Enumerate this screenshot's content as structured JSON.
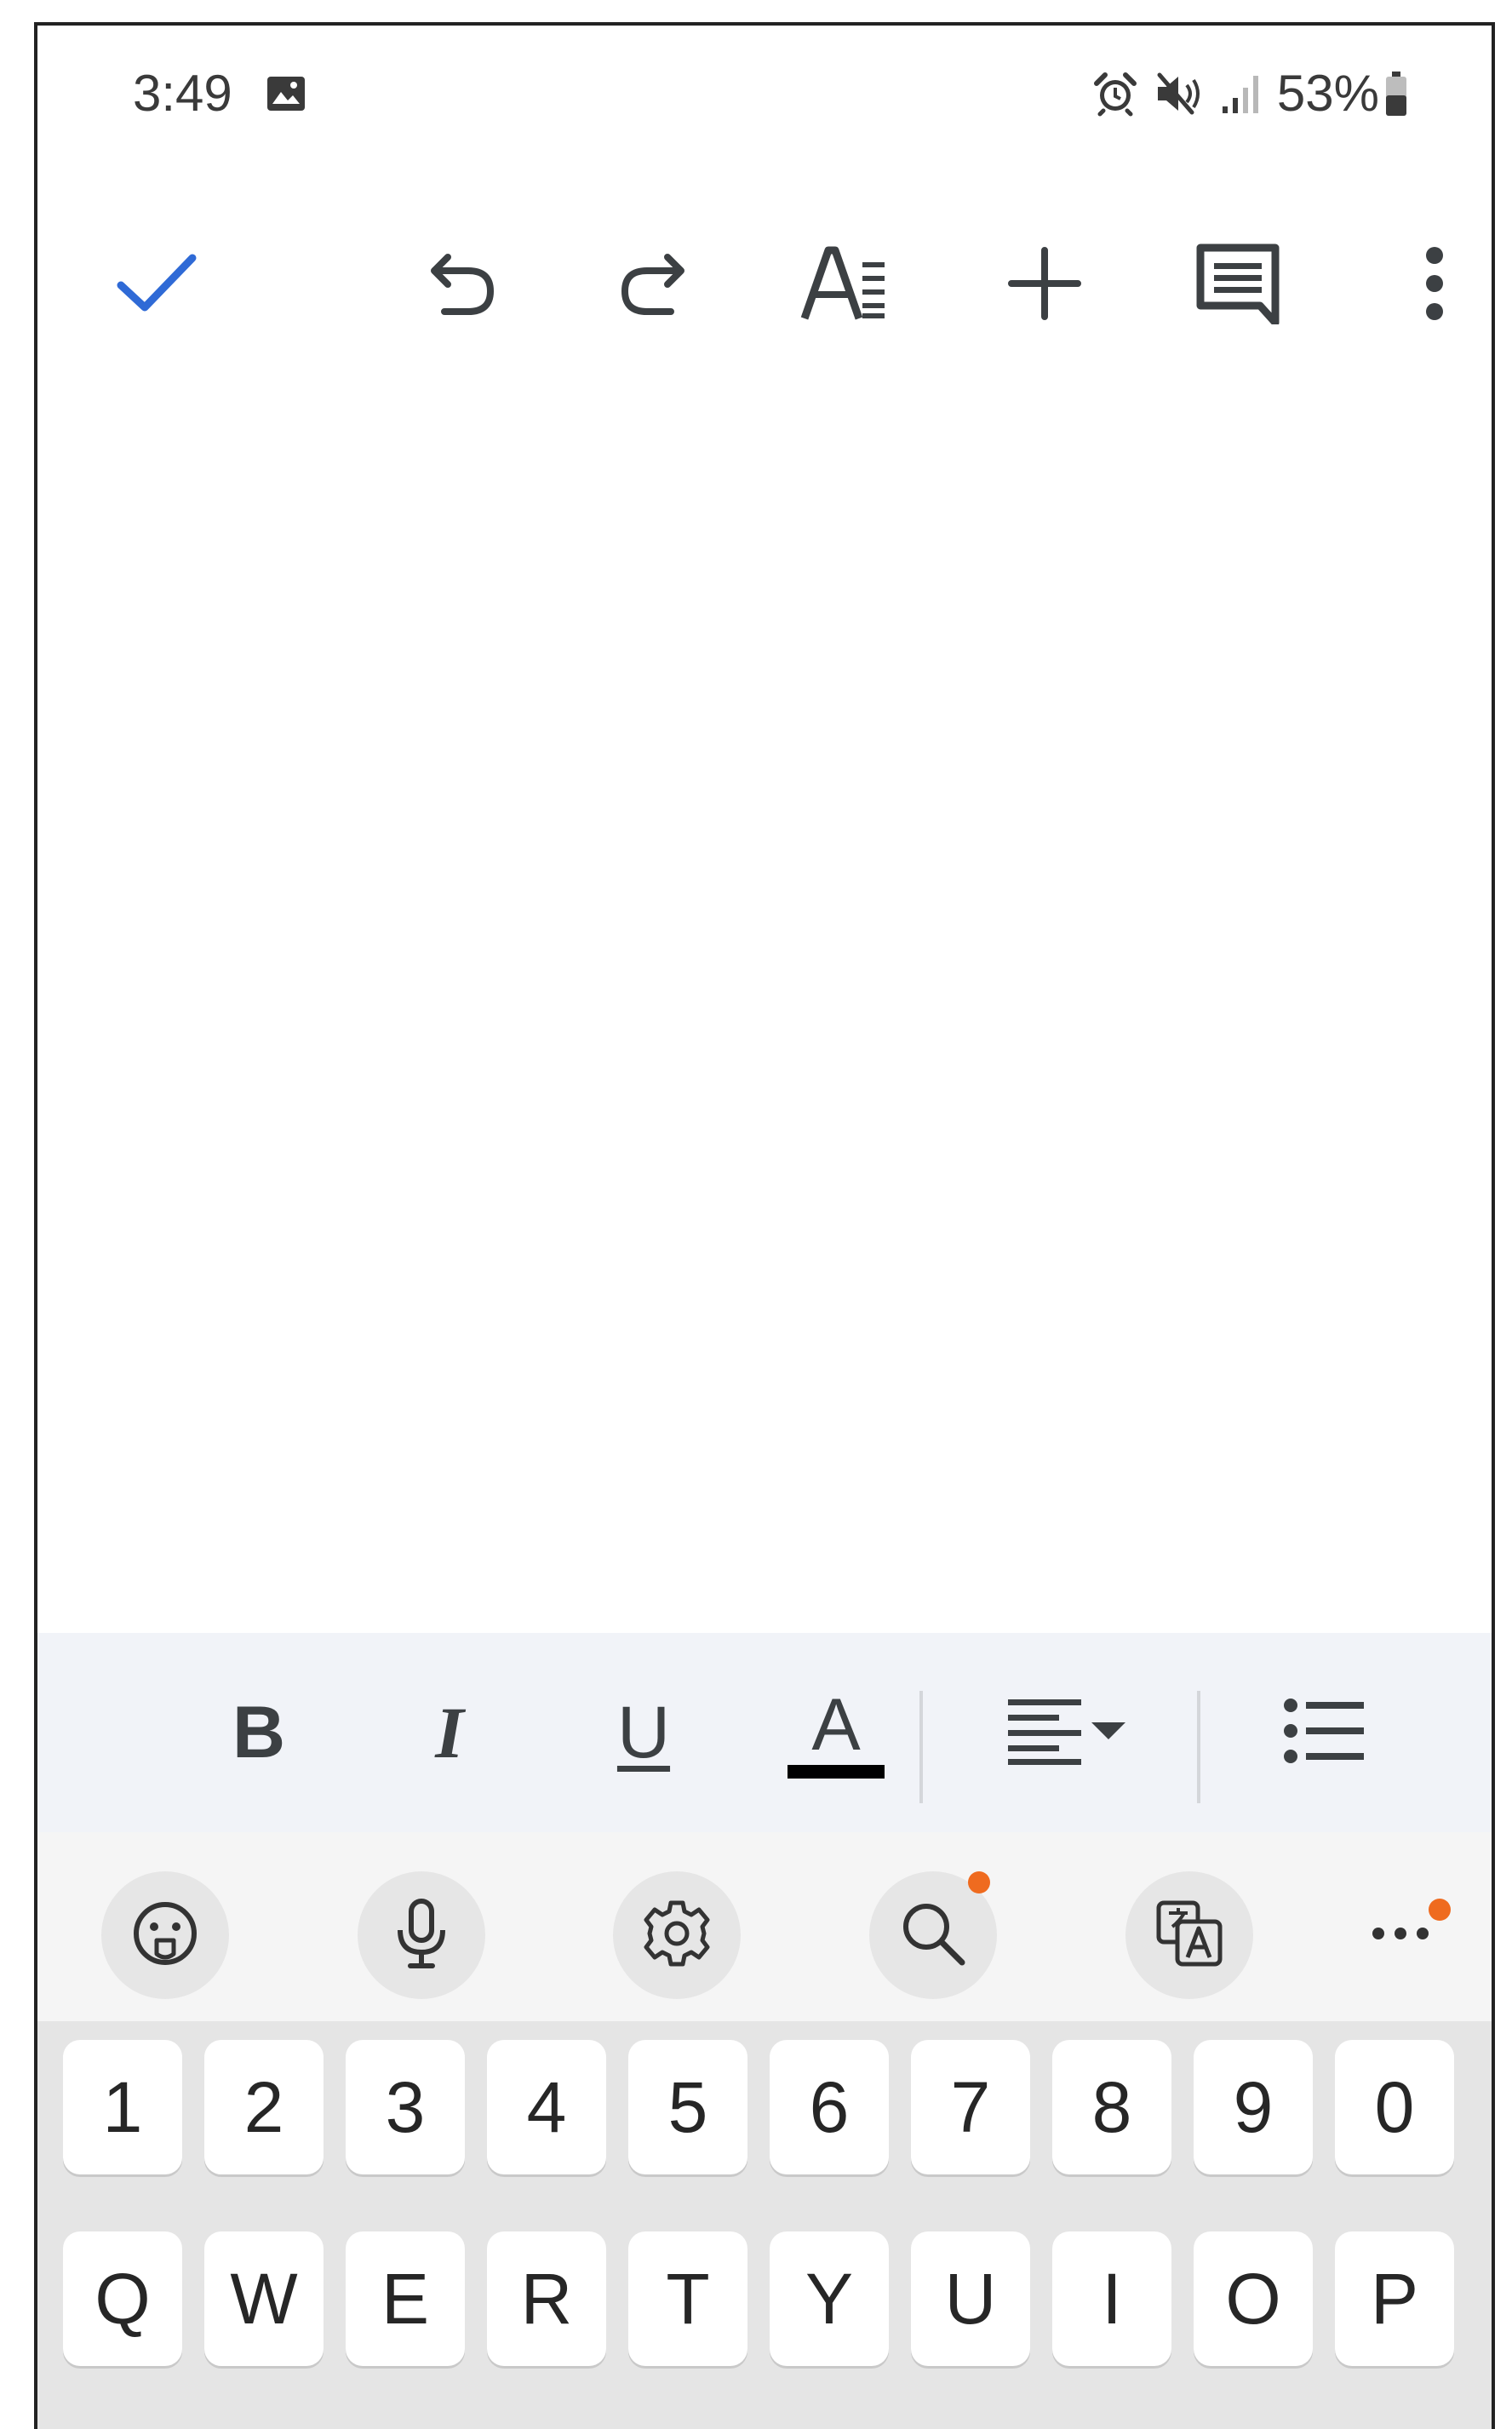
{
  "status_bar": {
    "time": "3:49",
    "battery": "53%",
    "icons": [
      "gallery-icon",
      "alarm-icon",
      "mute-icon",
      "signal-icon",
      "battery-icon"
    ]
  },
  "toolbar": {
    "icons": [
      "check-icon",
      "undo-icon",
      "redo-icon",
      "text-format-icon",
      "insert-icon",
      "comment-icon",
      "more-vertical-icon"
    ],
    "accent_color": "#2f6ad6"
  },
  "format_bar": {
    "bold_label": "B",
    "italic_label": "I",
    "underline_label": "U",
    "text_color_label": "A",
    "text_color_value": "#000000",
    "icons": [
      "align-left-icon",
      "dropdown-arrow-icon",
      "bulleted-list-icon"
    ]
  },
  "keyboard": {
    "toolbar_icons": [
      "emoji-icon",
      "microphone-icon",
      "settings-icon",
      "search-icon",
      "translate-icon",
      "more-horizontal-icon"
    ],
    "badge_color": "#ef6b1f",
    "number_row": [
      "1",
      "2",
      "3",
      "4",
      "5",
      "6",
      "7",
      "8",
      "9",
      "0"
    ],
    "letter_row": [
      "Q",
      "W",
      "E",
      "R",
      "T",
      "Y",
      "U",
      "I",
      "O",
      "P"
    ]
  }
}
